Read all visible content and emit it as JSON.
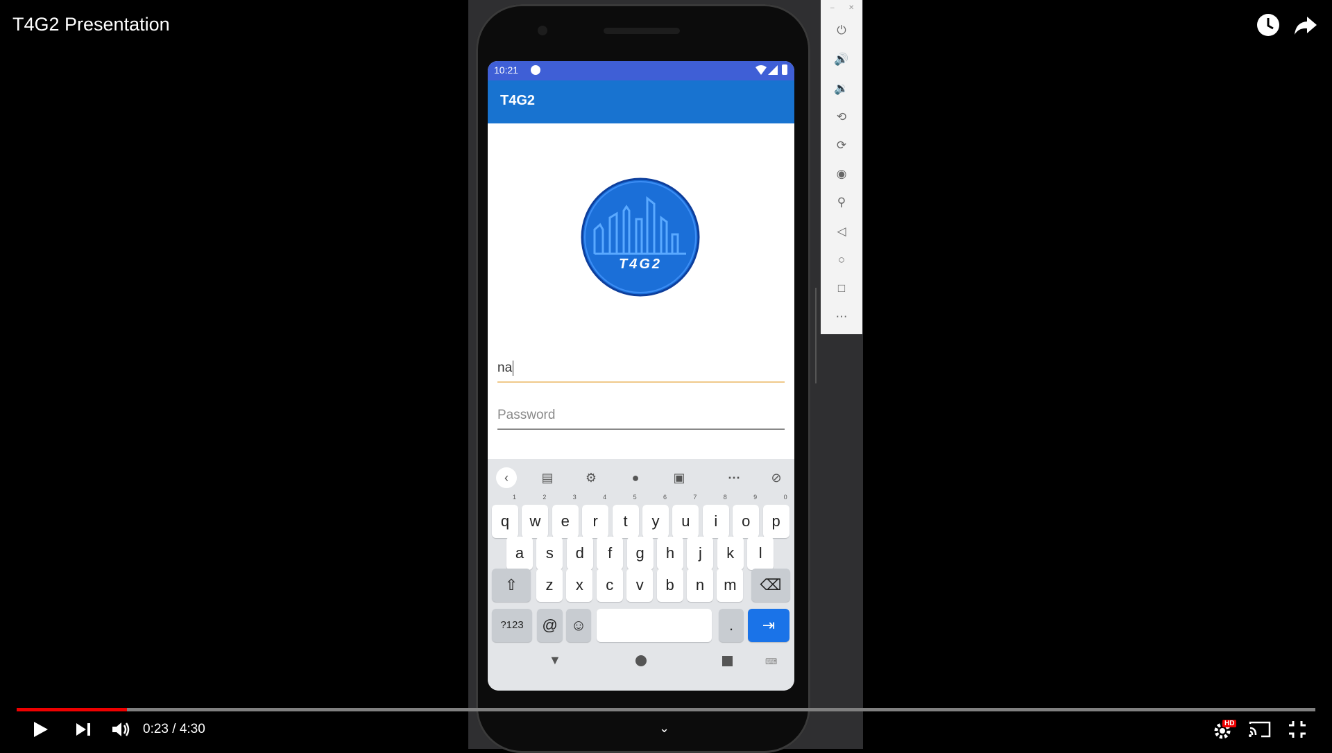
{
  "video": {
    "title": "T4G2 Presentation",
    "time_current": "0:23",
    "time_separator": "/",
    "time_total": "4:30",
    "progress_fraction": 0.085,
    "quality_badge": "HD",
    "buttons": [
      "play",
      "next",
      "volume",
      "settings",
      "cast",
      "exit-fullscreen",
      "watch-later",
      "share"
    ]
  },
  "emulator_toolbar": {
    "buttons": [
      "power",
      "volume-up",
      "volume-down",
      "rotate-left",
      "rotate-right",
      "screenshot",
      "zoom",
      "back",
      "home",
      "overview",
      "more"
    ]
  },
  "android": {
    "status_time": "10:21",
    "app_title": "T4G2",
    "logo_text": "T4G2",
    "username_value": "na",
    "password_placeholder": "Password"
  },
  "keyboard": {
    "row1": [
      {
        "k": "q",
        "h": "1"
      },
      {
        "k": "w",
        "h": "2"
      },
      {
        "k": "e",
        "h": "3"
      },
      {
        "k": "r",
        "h": "4"
      },
      {
        "k": "t",
        "h": "5"
      },
      {
        "k": "y",
        "h": "6"
      },
      {
        "k": "u",
        "h": "7"
      },
      {
        "k": "i",
        "h": "8"
      },
      {
        "k": "o",
        "h": "9"
      },
      {
        "k": "p",
        "h": "0"
      }
    ],
    "row2": [
      "a",
      "s",
      "d",
      "f",
      "g",
      "h",
      "j",
      "k",
      "l"
    ],
    "row3": [
      "z",
      "x",
      "c",
      "v",
      "b",
      "n",
      "m"
    ],
    "symbols_key": "?123",
    "at_key": "@",
    "period_key": "."
  },
  "colors": {
    "status_bar": "#3f5fd6",
    "app_bar": "#1873d0",
    "progress": "#ee0000",
    "enter_key": "#1a73e8",
    "focused_field_line": "#f0c98a"
  }
}
